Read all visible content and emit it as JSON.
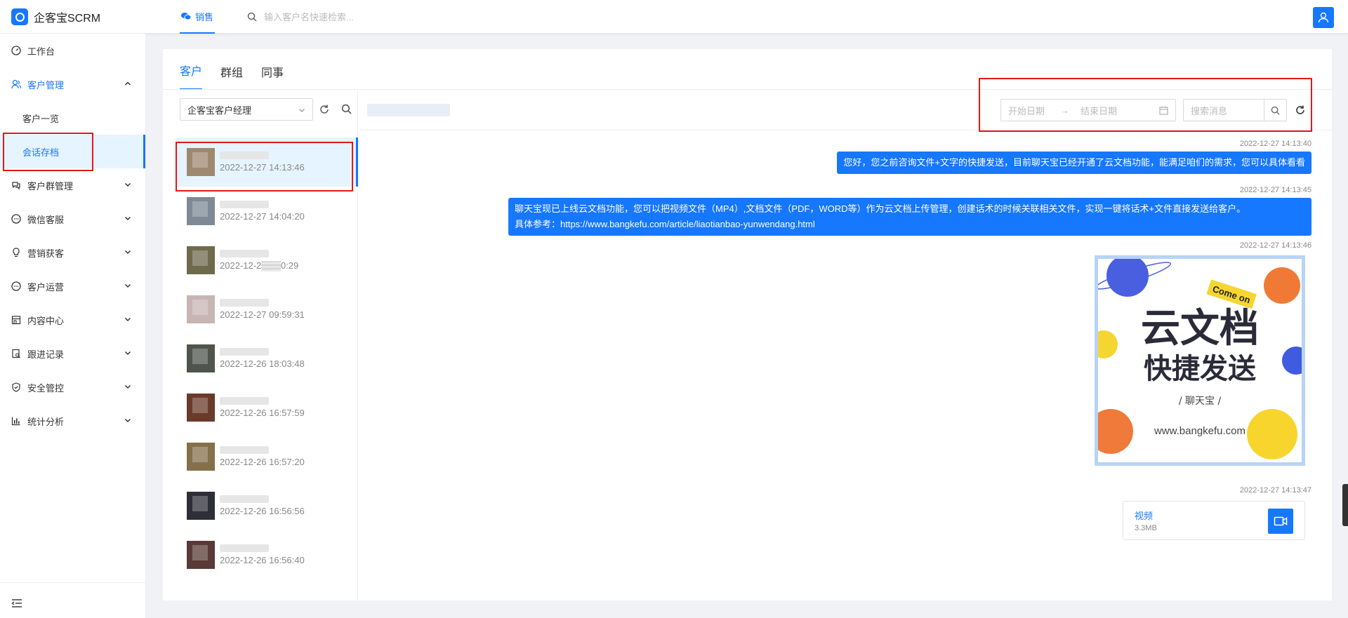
{
  "app": {
    "title": "企客宝SCRM"
  },
  "topbar": {
    "tab_label": "销售",
    "search_placeholder": "输入客户名快速检索..."
  },
  "sidebar": {
    "items": [
      {
        "label": "工作台",
        "icon": "dashboard-icon"
      },
      {
        "label": "客户管理",
        "icon": "users-icon",
        "expanded": true
      },
      {
        "label": "客户一览",
        "sub": true
      },
      {
        "label": "会话存档",
        "sub": true,
        "selected": true
      },
      {
        "label": "客户群管理",
        "icon": "group-chat-icon"
      },
      {
        "label": "微信客服",
        "icon": "chat-icon"
      },
      {
        "label": "营销获客",
        "icon": "bulb-icon"
      },
      {
        "label": "客户运营",
        "icon": "chat-dots-icon"
      },
      {
        "label": "内容中心",
        "icon": "store-icon"
      },
      {
        "label": "跟进记录",
        "icon": "doc-search-icon"
      },
      {
        "label": "安全管控",
        "icon": "shield-icon"
      },
      {
        "label": "统计分析",
        "icon": "bar-chart-icon"
      }
    ]
  },
  "main": {
    "tabs": [
      "客户",
      "群组",
      "同事"
    ],
    "manager_select": "企客宝客户经理",
    "list": [
      {
        "time": "2022-12-27 14:13:46",
        "selected": true,
        "avatar_color": "#a08870"
      },
      {
        "time": "2022-12-27 14:04:20",
        "avatar_color": "#7d8a96"
      },
      {
        "time": "2022-12-2▒▒▒0:29",
        "avatar_color": "#6e6a4c"
      },
      {
        "time": "2022-12-27 09:59:31",
        "avatar_color": "#c7b5b5"
      },
      {
        "time": "2022-12-26 18:03:48",
        "avatar_color": "#4f554c"
      },
      {
        "time": "2022-12-26 16:57:59",
        "avatar_color": "#6a3a2a"
      },
      {
        "time": "2022-12-26 16:57:20",
        "avatar_color": "#84704a"
      },
      {
        "time": "2022-12-26 16:56:56",
        "avatar_color": "#2e2e38"
      },
      {
        "time": "2022-12-26 16:56:40",
        "avatar_color": "#5a3a36"
      }
    ],
    "filters": {
      "start_date": "开始日期",
      "end_date": "结束日期",
      "search_placeholder": "搜索消息"
    },
    "messages": [
      {
        "time": "2022-12-27 14:13:40",
        "text": "您好，您之前咨询文件+文字的快捷发送，目前聊天宝已经开通了云文档功能，能满足咱们的需求，您可以具体看看"
      },
      {
        "time": "2022-12-27 14:13:45",
        "line1": "聊天宝现已上线云文档功能，您可以把视频文件（MP4）,文档文件（PDF，WORD等）作为云文档上传管理，创建话术的时候关联相关文件，实现一键将话术+文件直接发送给客户。",
        "line2": "具体参考：https://www.bangkefu.com/article/liaotianbao-yunwendang.html"
      },
      {
        "time": "2022-12-27 14:13:46",
        "image": {
          "badge": "Come on",
          "title1": "云文档",
          "title2": "快捷发送",
          "brand": "/ 聊天宝 /",
          "url": "www.bangkefu.com"
        }
      },
      {
        "time": "2022-12-27 14:13:47",
        "video": {
          "label": "视频",
          "size": "3.3MB"
        }
      }
    ]
  },
  "colors": {
    "accent": "#1677ff",
    "annotation": "#e01919"
  }
}
